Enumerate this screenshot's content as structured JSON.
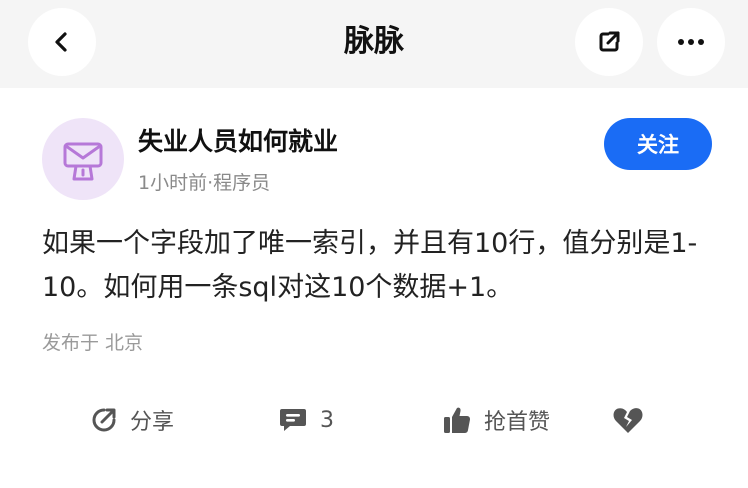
{
  "header": {
    "title": "脉脉",
    "back_icon": "chevron-left-icon",
    "share_icon": "external-share-icon",
    "more_icon": "more-dots-icon"
  },
  "post": {
    "author": "失业人员如何就业",
    "meta": "1小时前·程序员",
    "follow_label": "关注",
    "content": "如果一个字段加了唯一索引，并且有10行，值分别是1-10。如何用一条sql对这10个数据+1。",
    "location": "发布于 北京"
  },
  "actions": {
    "share_label": "分享",
    "comment_count": "3",
    "like_label": "抢首赞"
  },
  "colors": {
    "accent": "#1a6cf5",
    "header_bg": "#f5f5f5",
    "avatar_bg": "#efe4f8",
    "avatar_icon": "#b678d8"
  }
}
